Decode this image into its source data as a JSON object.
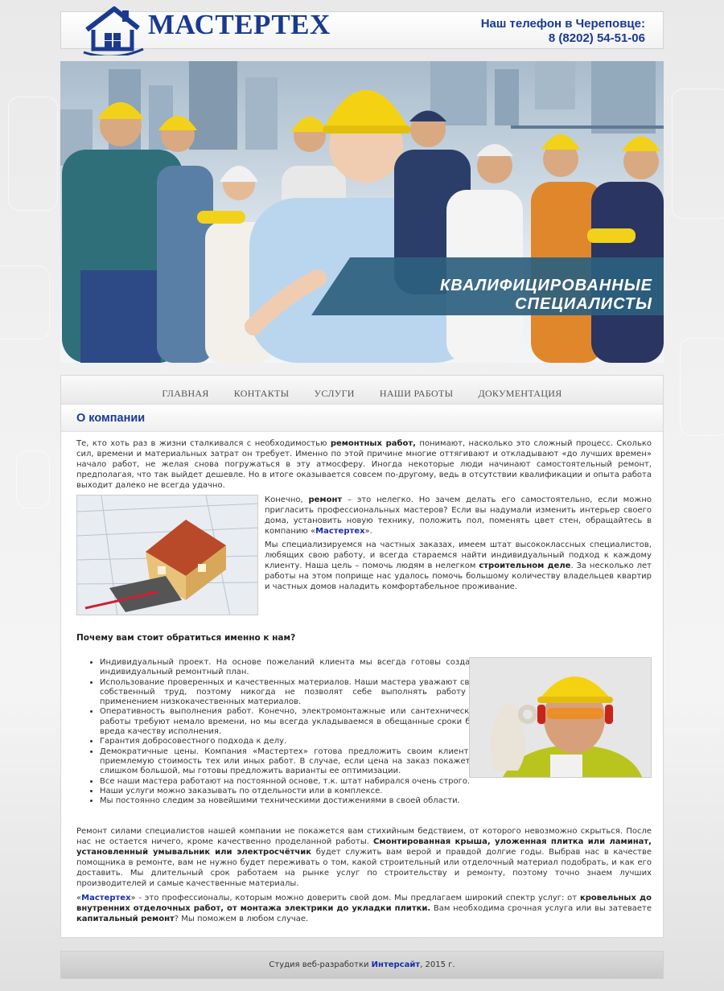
{
  "header": {
    "logo_text": "МАСТЕРТЕХ",
    "phone_label": "Наш телефон в Череповце:",
    "phone_number": "8 (8202) 54-51-06"
  },
  "banner": {
    "caption": "КВАЛИФИЦИРОВАННЫЕ  СПЕЦИАЛИСТЫ"
  },
  "nav": {
    "items": [
      "ГЛАВНАЯ",
      "КОНТАКТЫ",
      "УСЛУГИ",
      "НАШИ РАБОТЫ",
      "ДОКУМЕНТАЦИЯ"
    ]
  },
  "main": {
    "title": "О компании",
    "intro": {
      "a": "Те, кто хоть раз в жизни сталкивался с необходимостью ",
      "b": "ремонтных работ,",
      "c": " понимают, насколько это сложный процесс. Сколько сил, времени и материальных затрат он требует. Именно по этой причине многие оттягивают и откладывают «до лучших времен» начало работ, не желая снова погружаться в эту атмосферу. Иногда некоторые люди начинают самостоятельный ремонт, предполагая, что так выйдет дешевле. Но в итоге оказывается совсем по-другому, ведь в отсутствии квалификации и опыта работа выходит далеко не всегда удачно."
    },
    "para2": {
      "a": "Конечно, ",
      "b": "ремонт",
      "c": " – это нелегко. Но зачем делать его самостоятельно, если можно пригласить профессиональных мастеров? Если вы надумали изменить интерьер своего дома, установить новую технику, положить пол, поменять цвет стен, обращайтесь в компанию «",
      "brand": "Мастертех",
      "d": "»."
    },
    "para3": {
      "a": "Мы специализируемся на частных заказах, имеем штат высококлассных специалистов, любящих свою работу, и всегда стараемся найти индивидуальный подход к каждому клиенту. Наша цель – помочь людям в нелегком ",
      "b": "строительном деле",
      "c": ". За несколько лет работы на этом поприще нас удалось помочь большому количеству владельцев квартир и частных домов наладить комфортабельное проживание."
    },
    "why_title": "Почему вам стоит обратиться именно к нам?",
    "reasons": [
      "Индивидуальный проект. На основе пожеланий клиента мы всегда готовы создать индивидуальный ремонтный план.",
      "Использование проверенных и качественных материалов. Наши мастера уважают свой собственный труд, поэтому никогда не позволят себе выполнять работу с применением низкокачественных материалов.",
      "Оперативность выполнения работ. Конечно, электромонтажные или сантехнические работы требуют немало времени, но мы всегда укладываемся в обещанные сроки без вреда качеству исполнения.",
      "Гарантия добросовестного подхода к делу.",
      "Демократичные цены. Компания «Мастертех» готова предложить своим клиентам приемлемую стоимость тех или иных работ. В случае, если цена на заказ покажется слишком большой, мы готовы предложить варианты ее оптимизации.",
      "Все наши мастера работают на постоянной основе, т.к. штат набирался очень строго.",
      "Наши услуги можно заказывать по отдельности или в комплексе.",
      "Мы постоянно следим за новейшими техническими достижениями в своей области."
    ],
    "para4": {
      "a": "Ремонт силами специалистов нашей компании не покажется вам стихийным бедствием, от которого невозможно скрыться. После нас не остается ничего, кроме качественно проделанной работы. ",
      "b": "Смонтированная крыша, уложенная плитка или ламинат, установленный умывальник или электросчётчик",
      "c": " будет служить вам верой и правдой долгие годы. Выбрав нас в качестве помощника в ремонте, вам не нужно будет переживать о том, какой строительный или отделочный материал подобрать, и как его доставить. Мы длительный срок работаем на рынке услуг по строительству и ремонту, поэтому точно знаем лучших производителей и самые качественные материалы."
    },
    "para5": {
      "a": "«",
      "brand": "Мастертех",
      "b": "» - это профессионалы, которым можно доверить свой дом. Мы предлагаем широкий спектр услуг: от ",
      "c": "кровельных до внутренних отделочных работ, от монтажа электрики до укладки плитки.",
      "d": " Вам необходима срочная услуга или вы затеваете ",
      "e": "капитальный ремонт",
      "f": "? Мы поможем в любом случае."
    }
  },
  "footer": {
    "prefix": "Студия веб-разработки ",
    "link": "Интерсайт",
    "suffix": ", 2015 г."
  },
  "colors": {
    "brand_blue": "#1a3a8f",
    "link_blue": "#1a2ea8",
    "banner_caption": "#2c607e"
  }
}
